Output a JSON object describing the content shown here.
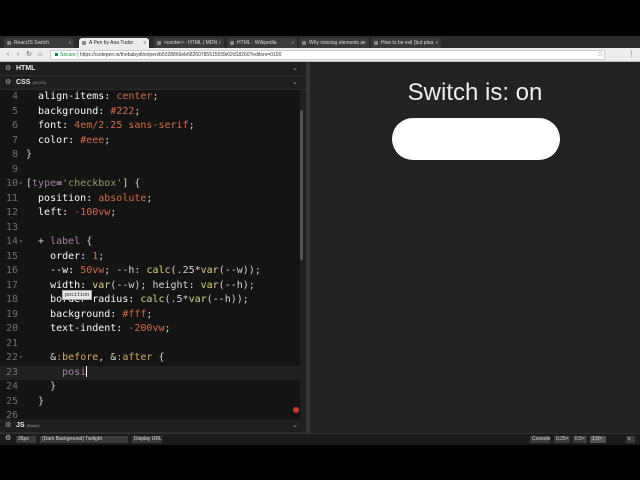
{
  "browser": {
    "tabs": [
      {
        "label": "ReactJS Switch",
        "active": false
      },
      {
        "label": "A Pen by Ana Tudor",
        "active": true
      },
      {
        "label": "<center> - HTML | MDN",
        "active": false
      },
      {
        "label": "HTML - Wikipedia",
        "active": false
      },
      {
        "label": "Why missing elements ar",
        "active": false
      },
      {
        "label": "How to be evil (but plea",
        "active": false
      }
    ],
    "close_glyph": "x",
    "nav": {
      "back": "‹",
      "forward": "›",
      "reload": "↻",
      "home": "⌂"
    },
    "address": {
      "secure_label": "Secure",
      "url": "https://codepen.io/thebabydino/pen/b5028866eb682607855155f3b02d18260?editors=0100"
    },
    "star_glyph": "☆",
    "menu_glyph": "⋮"
  },
  "editor": {
    "html_panel": {
      "title": "HTML",
      "chevron": "⌄",
      "gear": "⚙"
    },
    "css_panel": {
      "title": "CSS",
      "subtitle": "(SCSS)",
      "chevron": "⌄",
      "gear": "⚙"
    },
    "js_panel": {
      "title": "JS",
      "subtitle": "(Babel)",
      "chevron": "⌄",
      "gear": "⚙"
    },
    "autocomplete": "position",
    "code_lines": [
      {
        "num": "4",
        "fold": "",
        "segments": [
          {
            "t": "  align-items: ",
            "c": "prop"
          },
          {
            "t": "center",
            "c": "val"
          },
          {
            "t": ";",
            "c": "pun"
          }
        ]
      },
      {
        "num": "5",
        "fold": "",
        "segments": [
          {
            "t": "  background: ",
            "c": "prop"
          },
          {
            "t": "#222",
            "c": "num"
          },
          {
            "t": ";",
            "c": "pun"
          }
        ]
      },
      {
        "num": "6",
        "fold": "",
        "segments": [
          {
            "t": "  font: ",
            "c": "prop"
          },
          {
            "t": "4em/2.25 ",
            "c": "num"
          },
          {
            "t": "sans-serif",
            "c": "val"
          },
          {
            "t": ";",
            "c": "pun"
          }
        ]
      },
      {
        "num": "7",
        "fold": "",
        "segments": [
          {
            "t": "  color: ",
            "c": "prop"
          },
          {
            "t": "#eee",
            "c": "num"
          },
          {
            "t": ";",
            "c": "pun"
          }
        ]
      },
      {
        "num": "8",
        "fold": "",
        "segments": [
          {
            "t": "}",
            "c": "pun"
          }
        ]
      },
      {
        "num": "9",
        "fold": "",
        "segments": [
          {
            "t": "",
            "c": "pun"
          }
        ]
      },
      {
        "num": "10",
        "fold": "▾",
        "segments": [
          {
            "t": "[",
            "c": "pun"
          },
          {
            "t": "type",
            "c": "sel"
          },
          {
            "t": "=",
            "c": "pun"
          },
          {
            "t": "'checkbox'",
            "c": "str"
          },
          {
            "t": "] {",
            "c": "pun"
          }
        ]
      },
      {
        "num": "11",
        "fold": "",
        "segments": [
          {
            "t": "  position: ",
            "c": "prop"
          },
          {
            "t": "absolute",
            "c": "val"
          },
          {
            "t": ";",
            "c": "pun"
          }
        ]
      },
      {
        "num": "12",
        "fold": "",
        "segments": [
          {
            "t": "  left: ",
            "c": "prop"
          },
          {
            "t": "-100vw",
            "c": "num"
          },
          {
            "t": ";",
            "c": "pun"
          }
        ]
      },
      {
        "num": "13",
        "fold": "",
        "segments": [
          {
            "t": "",
            "c": "pun"
          }
        ]
      },
      {
        "num": "14",
        "fold": "▾",
        "segments": [
          {
            "t": "  + ",
            "c": "pun"
          },
          {
            "t": "label",
            "c": "sel"
          },
          {
            "t": " {",
            "c": "pun"
          }
        ]
      },
      {
        "num": "15",
        "fold": "",
        "segments": [
          {
            "t": "    order: ",
            "c": "prop"
          },
          {
            "t": "1",
            "c": "num"
          },
          {
            "t": ";",
            "c": "pun"
          }
        ]
      },
      {
        "num": "16",
        "fold": "",
        "segments": [
          {
            "t": "    --w: ",
            "c": "prop"
          },
          {
            "t": "50vw",
            "c": "num"
          },
          {
            "t": "; --h: ",
            "c": "pun"
          },
          {
            "t": "calc",
            "c": "fn"
          },
          {
            "t": "(.25*",
            "c": "pun"
          },
          {
            "t": "var",
            "c": "fn"
          },
          {
            "t": "(--w));",
            "c": "pun"
          }
        ]
      },
      {
        "num": "17",
        "fold": "",
        "segments": [
          {
            "t": "    width: ",
            "c": "prop"
          },
          {
            "t": "var",
            "c": "fn"
          },
          {
            "t": "(--w); height: ",
            "c": "pun"
          },
          {
            "t": "var",
            "c": "fn"
          },
          {
            "t": "(--h);",
            "c": "pun"
          }
        ]
      },
      {
        "num": "18",
        "fold": "",
        "segments": [
          {
            "t": "    border-radius: ",
            "c": "prop"
          },
          {
            "t": "calc",
            "c": "fn"
          },
          {
            "t": "(.5*",
            "c": "pun"
          },
          {
            "t": "var",
            "c": "fn"
          },
          {
            "t": "(--h));",
            "c": "pun"
          }
        ]
      },
      {
        "num": "19",
        "fold": "",
        "segments": [
          {
            "t": "    background: ",
            "c": "prop"
          },
          {
            "t": "#fff",
            "c": "num"
          },
          {
            "t": ";",
            "c": "pun"
          }
        ]
      },
      {
        "num": "20",
        "fold": "",
        "segments": [
          {
            "t": "    text-indent: ",
            "c": "prop"
          },
          {
            "t": "-200vw",
            "c": "num"
          },
          {
            "t": ";",
            "c": "pun"
          }
        ]
      },
      {
        "num": "21",
        "fold": "",
        "segments": [
          {
            "t": "",
            "c": "pun"
          }
        ]
      },
      {
        "num": "22",
        "fold": "▾",
        "segments": [
          {
            "t": "    &",
            "c": "pun"
          },
          {
            "t": ":before",
            "c": "kw"
          },
          {
            "t": ", &",
            "c": "pun"
          },
          {
            "t": ":after",
            "c": "kw"
          },
          {
            "t": " {",
            "c": "pun"
          }
        ]
      },
      {
        "num": "23",
        "fold": "",
        "current": true,
        "segments": [
          {
            "t": "      posi",
            "c": "sel"
          }
        ]
      },
      {
        "num": "24",
        "fold": "",
        "segments": [
          {
            "t": "    }",
            "c": "pun"
          }
        ]
      },
      {
        "num": "25",
        "fold": "",
        "segments": [
          {
            "t": "  }",
            "c": "pun"
          }
        ]
      },
      {
        "num": "26",
        "fold": "",
        "segments": [
          {
            "t": "",
            "c": "pun"
          }
        ]
      }
    ]
  },
  "preview": {
    "status_text": "Switch is: on"
  },
  "statusbar": {
    "gear": "⚙",
    "font_size": "26px",
    "theme": "(Dark Background) Twilight",
    "display_url": "Display URL",
    "console": "Console",
    "zoom_a": "0.25×",
    "zoom_b": "0.5×",
    "zoom_c": "1.0×",
    "close": "x"
  },
  "colors": {
    "preview_bg": "#222222",
    "editor_bg": "#141414",
    "switch_track": "#ffffff"
  }
}
